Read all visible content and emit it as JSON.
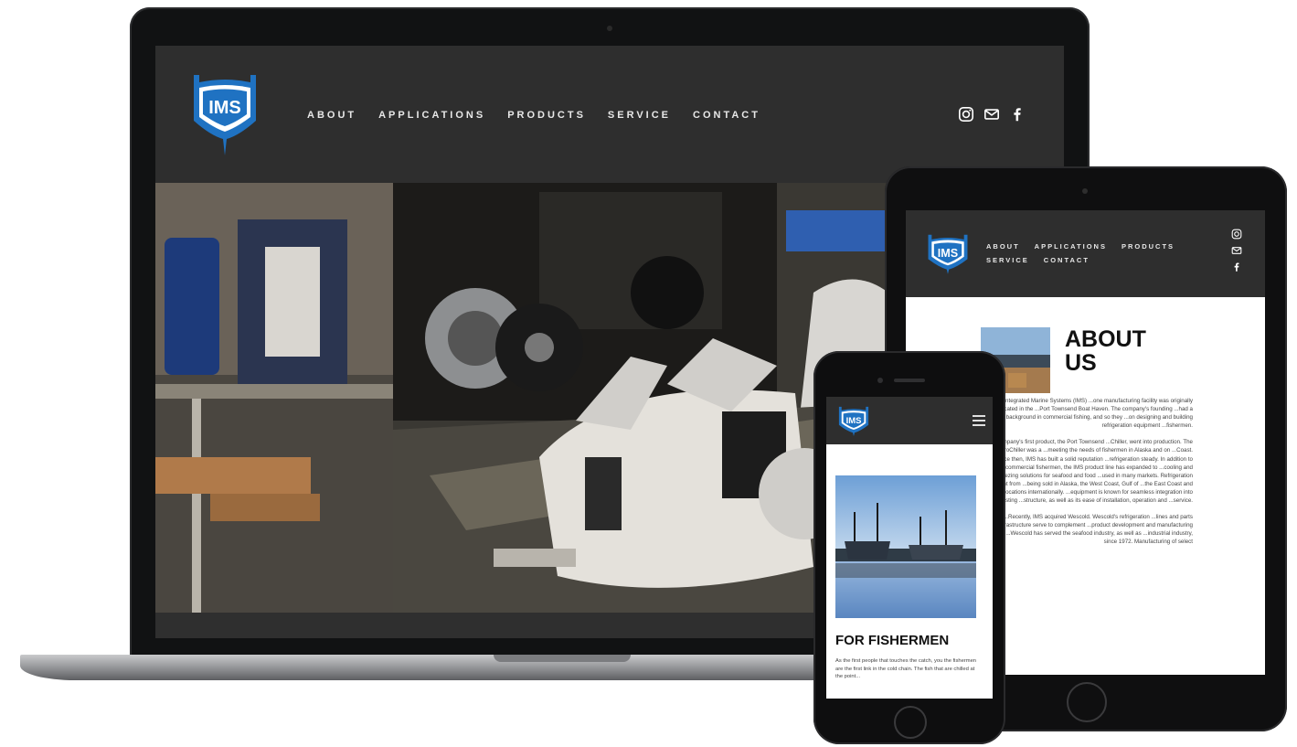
{
  "brand": {
    "logo_text": "IMS",
    "logo_color": "#1f72c2"
  },
  "nav": {
    "items": [
      {
        "label": "ABOUT"
      },
      {
        "label": "APPLICATIONS"
      },
      {
        "label": "PRODUCTS"
      },
      {
        "label": "SERVICE"
      },
      {
        "label": "CONTACT"
      }
    ]
  },
  "social": {
    "icons": [
      "instagram-icon",
      "mail-icon",
      "facebook-icon"
    ]
  },
  "tablet_page": {
    "about_title": "ABOUT US",
    "paragraphs": [
      "The Integrated Marine Systems (IMS) ...one manufacturing facility was originally located in the ...Port Townsend Boat Haven. The company's founding ...had a background in commercial fishing, and so they ...on designing and building refrigeration equipment ...fishermen.",
      "...the company's first product, the Port Townsend ...Chiller, went into production. The HydroChiller was a ...meeting the needs of fishermen in Alaska and on ...Coast. Since then, IMS has built a solid reputation ...refrigeration steady. In addition to serving ...commercial fishermen, the IMS product line has expanded to ...cooling and freezing solutions for seafood and food ...used in many markets. Refrigeration equipment from ...being sold in Alaska, the West Coast, Gulf of ...the East Coast and in select locations internationally. ...equipment is known for seamless integration into existing ...structure, as well as its ease of installation, operation and ...service.",
      "...Recently, IMS acquired Wescold. Wescold's refrigeration ...lines and parts infrastructure serve to complement ...product development and manufacturing business ...Wescold has served the seafood industry, as well as ...industrial industry, since 1972. Manufacturing of select"
    ]
  },
  "phone_page": {
    "section_title": "FOR FISHERMEN",
    "body": "As the first people that touches the catch, you the fishermen are the first link in the cold chain. The fish that are chilled at the point..."
  },
  "colors": {
    "header_bg": "#2e2e2e",
    "accent_blue": "#1f72c2",
    "nav_text": "#e8e8e8"
  }
}
